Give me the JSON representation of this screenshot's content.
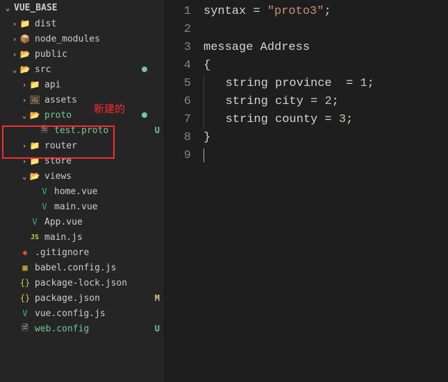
{
  "project": {
    "name": "VUE_BASE"
  },
  "annotation": "新建的",
  "tree": [
    {
      "chev": "›",
      "indent": 14,
      "icon": "📁",
      "iconClass": "folder-yellow",
      "label": "dist",
      "labelClass": "",
      "status": ""
    },
    {
      "chev": "›",
      "indent": 14,
      "icon": "📦",
      "iconClass": "folder-green",
      "label": "node_modules",
      "labelClass": "",
      "status": ""
    },
    {
      "chev": "›",
      "indent": 14,
      "icon": "📂",
      "iconClass": "folder-teal",
      "label": "public",
      "labelClass": "",
      "status": ""
    },
    {
      "chev": "⌄",
      "indent": 14,
      "icon": "📂",
      "iconClass": "folder-green",
      "label": "src",
      "labelClass": "",
      "status": "",
      "dot": true
    },
    {
      "chev": "›",
      "indent": 28,
      "icon": "📁",
      "iconClass": "folder-teal",
      "label": "api",
      "labelClass": "",
      "status": ""
    },
    {
      "chev": "›",
      "indent": 28,
      "icon": "🖼",
      "iconClass": "folder-yellow",
      "label": "assets",
      "labelClass": "",
      "status": ""
    },
    {
      "chev": "⌄",
      "indent": 28,
      "icon": "📂",
      "iconClass": "folder-green",
      "label": "proto",
      "labelClass": "green",
      "status": "",
      "dot": true
    },
    {
      "chev": " ",
      "indent": 42,
      "icon": "🗎",
      "iconClass": "file-icon",
      "label": "test.proto",
      "labelClass": "green",
      "status": "U"
    },
    {
      "chev": "›",
      "indent": 28,
      "icon": "📁",
      "iconClass": "folder-yellow",
      "label": "router",
      "labelClass": "",
      "status": ""
    },
    {
      "chev": "›",
      "indent": 28,
      "icon": "📁",
      "iconClass": "folder-yellow",
      "label": "store",
      "labelClass": "",
      "status": ""
    },
    {
      "chev": "⌄",
      "indent": 28,
      "icon": "📂",
      "iconClass": "folder-red",
      "label": "views",
      "labelClass": "",
      "status": ""
    },
    {
      "chev": " ",
      "indent": 42,
      "icon": "V",
      "iconClass": "vue-icon",
      "label": "home.vue",
      "labelClass": "",
      "status": ""
    },
    {
      "chev": " ",
      "indent": 42,
      "icon": "V",
      "iconClass": "vue-icon",
      "label": "main.vue",
      "labelClass": "",
      "status": ""
    },
    {
      "chev": " ",
      "indent": 28,
      "icon": "V",
      "iconClass": "vue-icon",
      "label": "App.vue",
      "labelClass": "",
      "status": ""
    },
    {
      "chev": " ",
      "indent": 28,
      "icon": "JS",
      "iconClass": "js-icon",
      "label": "main.js",
      "labelClass": "",
      "status": ""
    },
    {
      "chev": " ",
      "indent": 14,
      "icon": "◆",
      "iconClass": "git-icon",
      "label": ".gitignore",
      "labelClass": "",
      "status": ""
    },
    {
      "chev": " ",
      "indent": 14,
      "icon": "▦",
      "iconClass": "babel-icon",
      "label": "babel.config.js",
      "labelClass": "",
      "status": ""
    },
    {
      "chev": " ",
      "indent": 14,
      "icon": "{}",
      "iconClass": "json-icon",
      "label": "package-lock.json",
      "labelClass": "",
      "status": ""
    },
    {
      "chev": " ",
      "indent": 14,
      "icon": "{}",
      "iconClass": "json-icon",
      "label": "package.json",
      "labelClass": "",
      "status": "M"
    },
    {
      "chev": " ",
      "indent": 14,
      "icon": "V",
      "iconClass": "vue-icon",
      "label": "vue.config.js",
      "labelClass": "",
      "status": ""
    },
    {
      "chev": " ",
      "indent": 14,
      "icon": "🗎",
      "iconClass": "file-icon",
      "label": "web.config",
      "labelClass": "green",
      "status": "U"
    }
  ],
  "code": {
    "lines": [
      "syntax = \"proto3\";",
      "",
      "message Address",
      "{",
      "    string province  = 1;",
      "    string city = 2;",
      "    string county = 3;",
      "}",
      ""
    ]
  }
}
